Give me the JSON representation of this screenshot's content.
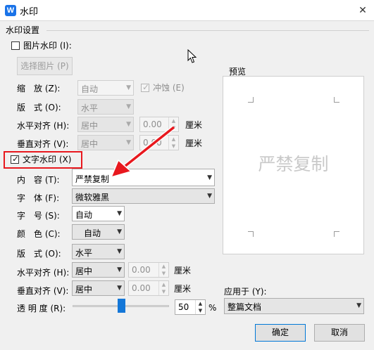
{
  "window": {
    "title": "水印",
    "app_icon_letter": "W",
    "close_glyph": "✕"
  },
  "group": {
    "title": "水印设置"
  },
  "picture": {
    "checkbox_label": "图片水印 (I):",
    "select_button": "选择图片 (P)",
    "scale_label": "缩　放 (Z):",
    "scale_value": "自动",
    "washout_label": "冲蚀 (E)",
    "layout_label": "版　式 (O):",
    "layout_value": "水平",
    "halign_label": "水平对齐 (H):",
    "halign_value": "居中",
    "halign_offset": "0.00",
    "halign_unit": "厘米",
    "valign_label": "垂直对齐 (V):",
    "valign_value": "居中",
    "valign_offset": "0.00",
    "valign_unit": "厘米"
  },
  "text": {
    "checkbox_label": "文字水印 (X)",
    "content_label": "内　容 (T):",
    "content_value": "严禁复制",
    "font_label": "字　体 (F):",
    "font_value": "微软雅黑",
    "size_label": "字　号 (S):",
    "size_value": "自动",
    "color_label": "颜　色 (C):",
    "color_value": "自动",
    "layout_label": "版　式 (O):",
    "layout_value": "水平",
    "halign_label": "水平对齐 (H):",
    "halign_value": "居中",
    "halign_offset": "0.00",
    "halign_unit": "厘米",
    "valign_label": "垂直对齐 (V):",
    "valign_value": "居中",
    "valign_offset": "0.00",
    "valign_unit": "厘米",
    "transparency_label": "透 明 度 (R):",
    "transparency_value": "50",
    "transparency_unit": "%",
    "transparency_level": 0.5
  },
  "preview": {
    "label": "预览",
    "watermark_text": "严禁复制"
  },
  "apply_to": {
    "label": "应用于 (Y):",
    "value": "整篇文档"
  },
  "buttons": {
    "ok": "确定",
    "cancel": "取消"
  },
  "icons": {
    "spin_up": "▲",
    "spin_down": "▼",
    "dropdown": "▼",
    "check": "✓"
  },
  "colors": {
    "accent": "#1477d8",
    "highlight": "#e8181e"
  }
}
